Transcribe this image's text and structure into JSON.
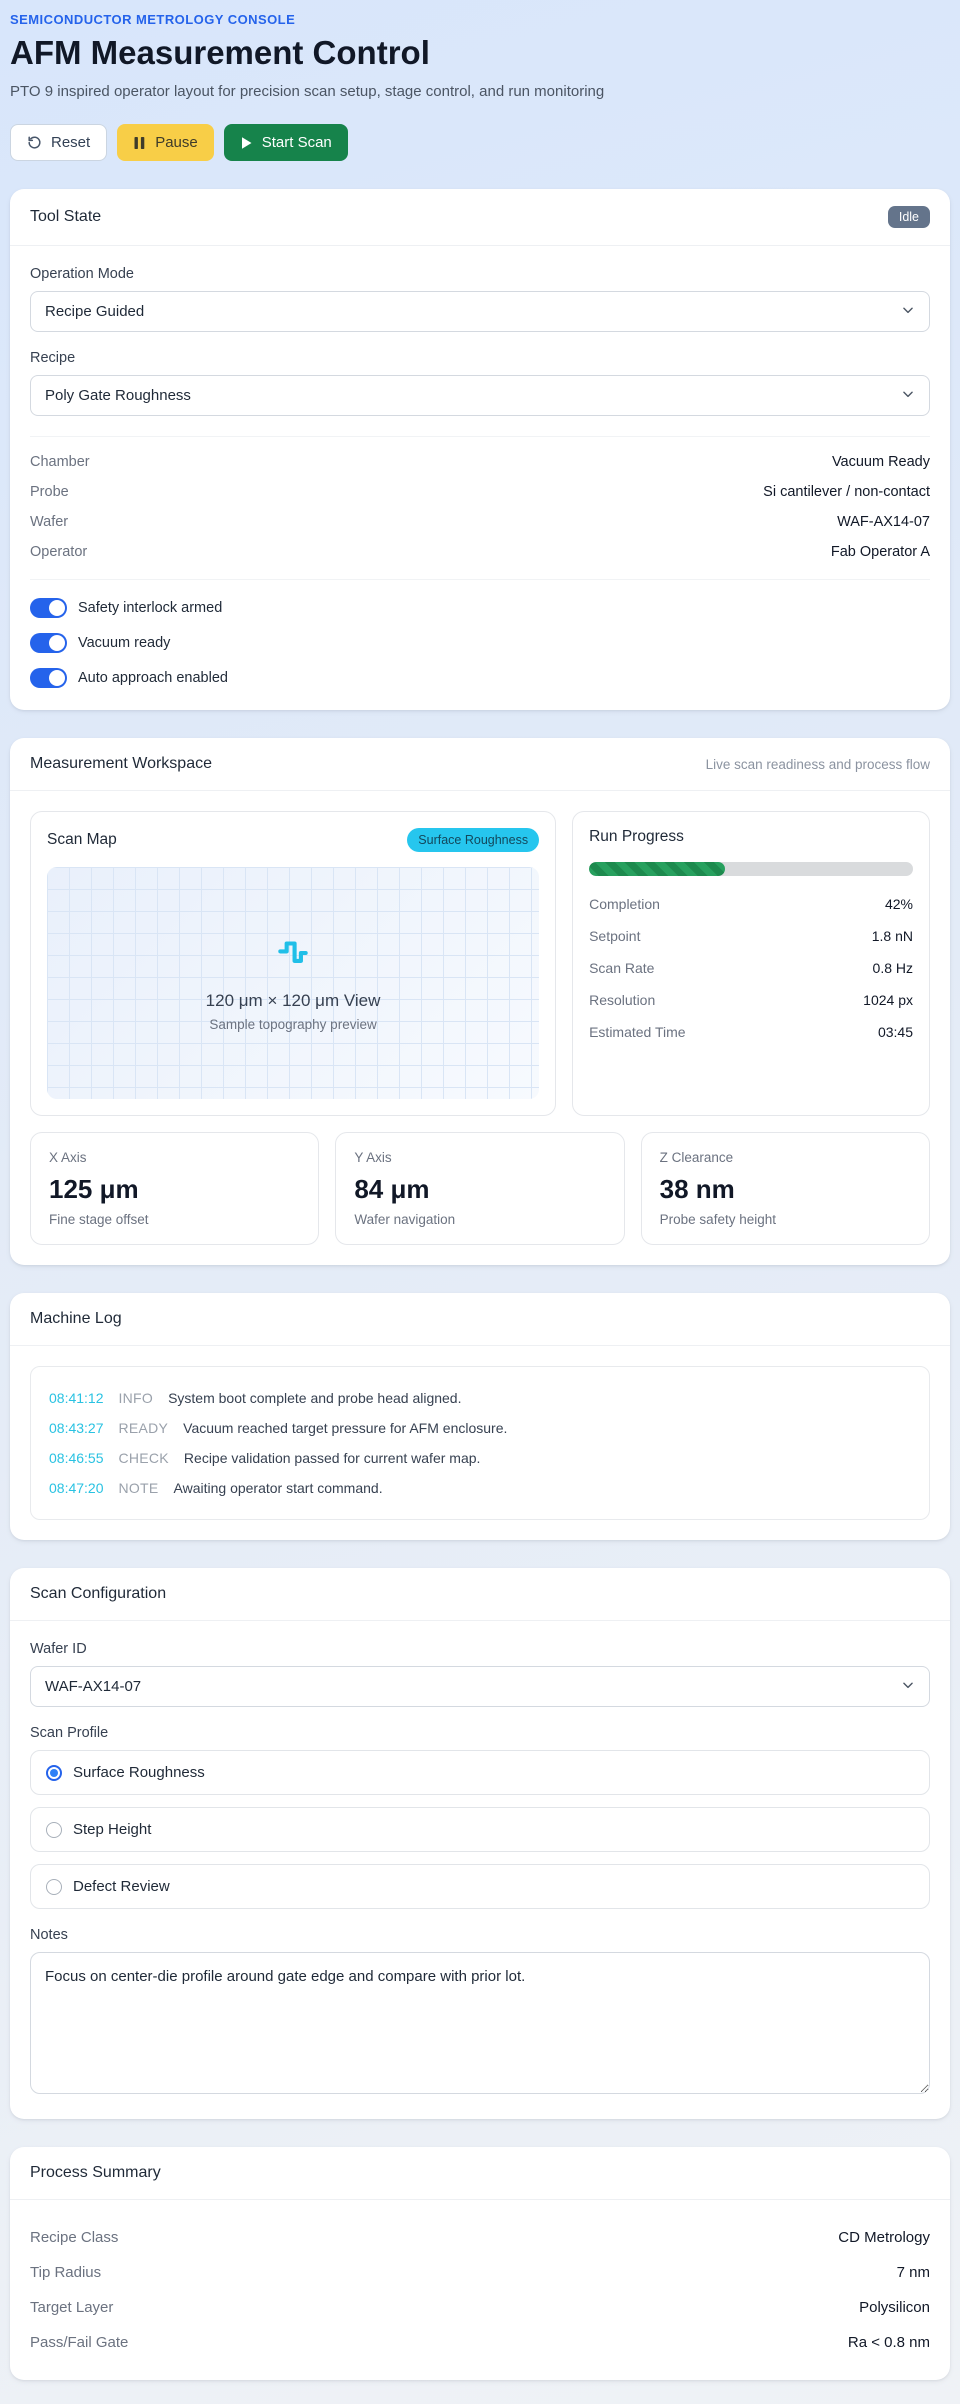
{
  "page": {
    "eyebrow": "SEMICONDUCTOR METROLOGY CONSOLE",
    "title": "AFM Measurement Control",
    "subtitle": "PTO 9 inspired operator layout for precision scan setup, stage control, and run monitoring"
  },
  "toolbar": {
    "reset_label": "Reset",
    "pause_label": "Pause",
    "start_label": "Start Scan"
  },
  "tool_state": {
    "title": "Tool State",
    "status_badge": "Idle",
    "operation_mode": {
      "label": "Operation Mode",
      "value": "Recipe Guided"
    },
    "recipe": {
      "label": "Recipe",
      "value": "Poly Gate Roughness"
    },
    "info_rows": [
      {
        "label": "Chamber",
        "value": "Vacuum Ready"
      },
      {
        "label": "Probe",
        "value": "Si cantilever / non-contact"
      },
      {
        "label": "Wafer",
        "value": "WAF-AX14-07"
      },
      {
        "label": "Operator",
        "value": "Fab Operator A"
      }
    ],
    "toggles": [
      {
        "label": "Safety interlock armed",
        "on": true
      },
      {
        "label": "Vacuum ready",
        "on": true
      },
      {
        "label": "Auto approach enabled",
        "on": true
      }
    ]
  },
  "workspace": {
    "title": "Measurement Workspace",
    "subtitle": "Live scan readiness and process flow",
    "scan_map": {
      "title": "Scan Map",
      "badge": "Surface Roughness",
      "view_label": "120 μm × 120 μm View",
      "view_sub": "Sample topography preview"
    },
    "run_progress": {
      "title": "Run Progress",
      "progress_pct": 42,
      "rows": [
        {
          "label": "Completion",
          "value": "42%"
        },
        {
          "label": "Setpoint",
          "value": "1.8 nN"
        },
        {
          "label": "Scan Rate",
          "value": "0.8 Hz"
        },
        {
          "label": "Resolution",
          "value": "1024 px"
        },
        {
          "label": "Estimated Time",
          "value": "03:45"
        }
      ]
    },
    "axis_cards": [
      {
        "label": "X Axis",
        "value": "125 μm",
        "caption": "Fine stage offset"
      },
      {
        "label": "Y Axis",
        "value": "84 μm",
        "caption": "Wafer navigation"
      },
      {
        "label": "Z Clearance",
        "value": "38 nm",
        "caption": "Probe safety height"
      }
    ]
  },
  "machine_log": {
    "title": "Machine Log",
    "entries": [
      {
        "time": "08:41:12",
        "level": "INFO",
        "message": "System boot complete and probe head aligned."
      },
      {
        "time": "08:43:27",
        "level": "READY",
        "message": "Vacuum reached target pressure for AFM enclosure."
      },
      {
        "time": "08:46:55",
        "level": "CHECK",
        "message": "Recipe validation passed for current wafer map."
      },
      {
        "time": "08:47:20",
        "level": "NOTE",
        "message": "Awaiting operator start command."
      }
    ]
  },
  "scan_config": {
    "title": "Scan Configuration",
    "wafer_id": {
      "label": "Wafer ID",
      "value": "WAF-AX14-07"
    },
    "scan_profile": {
      "label": "Scan Profile",
      "options": [
        {
          "label": "Surface Roughness",
          "selected": true
        },
        {
          "label": "Step Height",
          "selected": false
        },
        {
          "label": "Defect Review",
          "selected": false
        }
      ]
    },
    "notes": {
      "label": "Notes",
      "value": "Focus on center-die profile around gate edge and compare with prior lot."
    }
  },
  "process_summary": {
    "title": "Process Summary",
    "rows": [
      {
        "label": "Recipe Class",
        "value": "CD Metrology"
      },
      {
        "label": "Tip Radius",
        "value": "7 nm"
      },
      {
        "label": "Target Layer",
        "value": "Polysilicon"
      },
      {
        "label": "Pass/Fail Gate",
        "value": "Ra < 0.8 nm"
      }
    ]
  },
  "colors": {
    "accent_blue": "#2563eb",
    "action_green": "#16834b",
    "action_yellow": "#f8ce47",
    "badge_cyan": "#26c6ee",
    "badge_gray": "#64748b",
    "progress_green": "#1d8a4e",
    "log_time_cyan": "#29c2e2"
  }
}
